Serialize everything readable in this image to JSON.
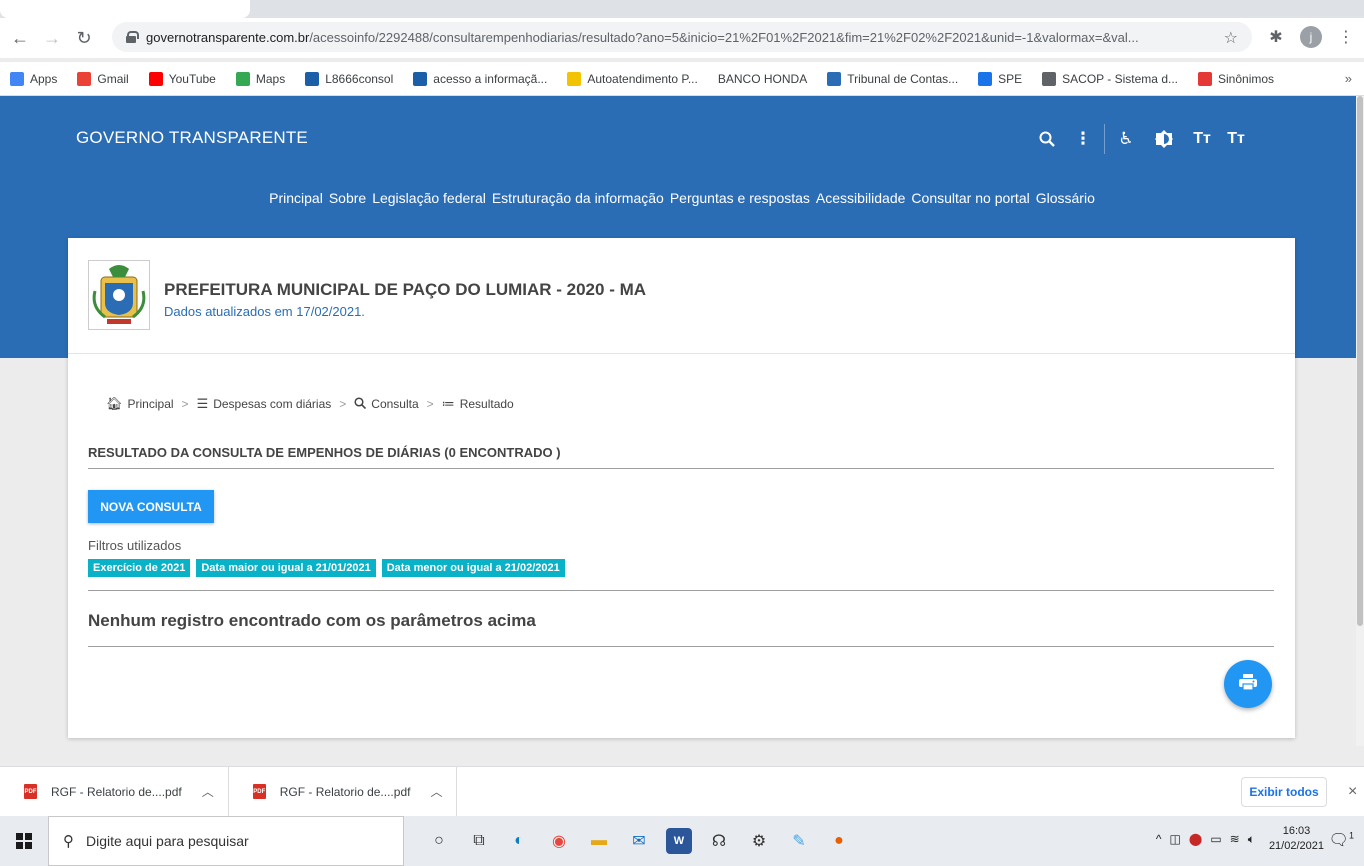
{
  "browser": {
    "url_host": "governotransparente.com.br",
    "url_path": "/acessoinfo/2292488/consultarempenhodiarias/resultado?ano=5&inicio=21%2F01%2F2021&fim=21%2F02%2F2021&unid=-1&valormax=&val...",
    "profile_initial": "j",
    "bookmarks": [
      {
        "label": "Apps",
        "color": "#4285f4"
      },
      {
        "label": "Gmail",
        "color": "#ea4335"
      },
      {
        "label": "YouTube",
        "color": "#ff0000"
      },
      {
        "label": "Maps",
        "color": "#34a853"
      },
      {
        "label": "L8666consol",
        "color": "#1a5fa8"
      },
      {
        "label": "acesso a informaçã...",
        "color": "#1a5fa8"
      },
      {
        "label": "Autoatendimento P...",
        "color": "#f2c300"
      },
      {
        "label": "BANCO HONDA",
        "color": "#ffffff"
      },
      {
        "label": "Tribunal de Contas...",
        "color": "#2a6db5"
      },
      {
        "label": "SPE",
        "color": "#1a73e8"
      },
      {
        "label": "SACOP - Sistema d...",
        "color": "#5f6368"
      },
      {
        "label": "Sinônimos",
        "color": "#e53935"
      }
    ],
    "bookmarks_more": "»"
  },
  "header": {
    "brand": "GOVERNO TRANSPARENTE",
    "nav": [
      "Principal",
      "Sobre",
      "Legislação federal",
      "Estruturação da informação",
      "Perguntas e respostas",
      "Acessibilidade",
      "Consultar no portal",
      "Glossário"
    ],
    "icon_text_plus": "Tт",
    "icon_text_minus": "Tт"
  },
  "org": {
    "name": "PREFEITURA MUNICIPAL DE PAÇO DO LUMIAR - 2020 - MA",
    "updated": "Dados atualizados em 17/02/2021."
  },
  "breadcrumb": [
    "Principal",
    "Despesas com diárias",
    "Consulta",
    "Resultado"
  ],
  "result": {
    "title": "RESULTADO DA CONSULTA DE EMPENHOS DE DIÁRIAS (0 ENCONTRADO )",
    "new_query_button": "NOVA CONSULTA",
    "filters_label": "Filtros utilizados",
    "filters": [
      "Exercício de 2021",
      "Data maior ou igual a 21/01/2021",
      "Data menor ou igual a 21/02/2021"
    ],
    "empty_message": "Nenhum registro encontrado com os parâmetros acima"
  },
  "downloads": {
    "items": [
      "RGF - Relatorio de....pdf",
      "RGF - Relatorio de....pdf"
    ],
    "pdf_badge": "PDF",
    "show_all": "Exibir todos",
    "close": "×"
  },
  "taskbar": {
    "search_placeholder": "Digite aqui para pesquisar",
    "time": "16:03",
    "date": "21/02/2021",
    "notification_count": "1"
  },
  "colors": {
    "brand_blue": "#2a6db5",
    "button_blue": "#2196f3",
    "chip_cyan": "#0ab2c8"
  }
}
